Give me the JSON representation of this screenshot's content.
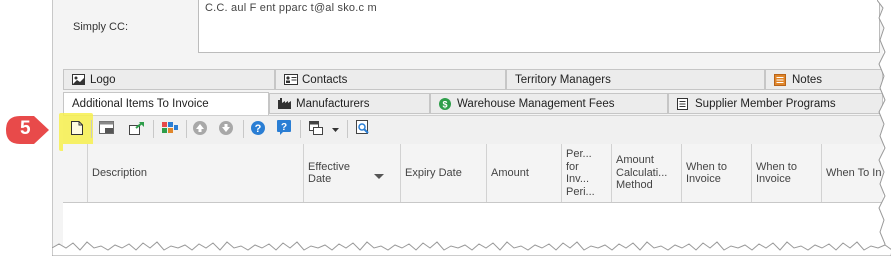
{
  "simply_cc": {
    "label": "Simply CC:",
    "value": "C.C.   aul F   ent   pparc  t@al  sko.c  m"
  },
  "tabs_row1": [
    {
      "label": "Logo",
      "icon": "image-icon"
    },
    {
      "label": "Contacts",
      "icon": "contact-card-icon"
    },
    {
      "label": "Territory Managers",
      "icon": ""
    },
    {
      "label": "Notes",
      "icon": "notes-icon"
    }
  ],
  "tabs_row2": [
    {
      "label": "Additional Items To Invoice",
      "active": true
    },
    {
      "label": "Manufacturers",
      "icon": "factory-icon"
    },
    {
      "label": "Warehouse Management Fees",
      "icon": "dollar-icon"
    },
    {
      "label": "Supplier Member Programs",
      "icon": "document-icon"
    }
  ],
  "toolbar": {
    "buttons": [
      "new-document-icon",
      "form-view-icon",
      "export-icon",
      "group-icon",
      "move-up-icon",
      "move-down-icon",
      "help-icon",
      "question-icon",
      "layout-icon",
      "dropdown-arrow-icon",
      "print-preview-icon"
    ]
  },
  "step_marker": {
    "number": "5",
    "color": "#e84a4a"
  },
  "grid": {
    "columns": [
      {
        "lines": [
          "Description"
        ]
      },
      {
        "lines": [
          "Effective",
          "Date"
        ],
        "sorted": "desc"
      },
      {
        "lines": [
          "Expiry Date"
        ]
      },
      {
        "lines": [
          "Amount"
        ]
      },
      {
        "lines": [
          "Per...",
          "for",
          "Inv...",
          "Peri..."
        ]
      },
      {
        "lines": [
          "Amount",
          "Calculati...",
          "Method"
        ]
      },
      {
        "lines": [
          "When to",
          "Invoice"
        ]
      },
      {
        "lines": [
          "When to",
          "Invoice"
        ]
      },
      {
        "lines": [
          "When To In"
        ]
      }
    ]
  },
  "colors": {
    "highlight": "#f7f04e",
    "accent_orange": "#e0862a",
    "accent_blue": "#2a7ed4",
    "accent_green": "#2e9e4a"
  }
}
